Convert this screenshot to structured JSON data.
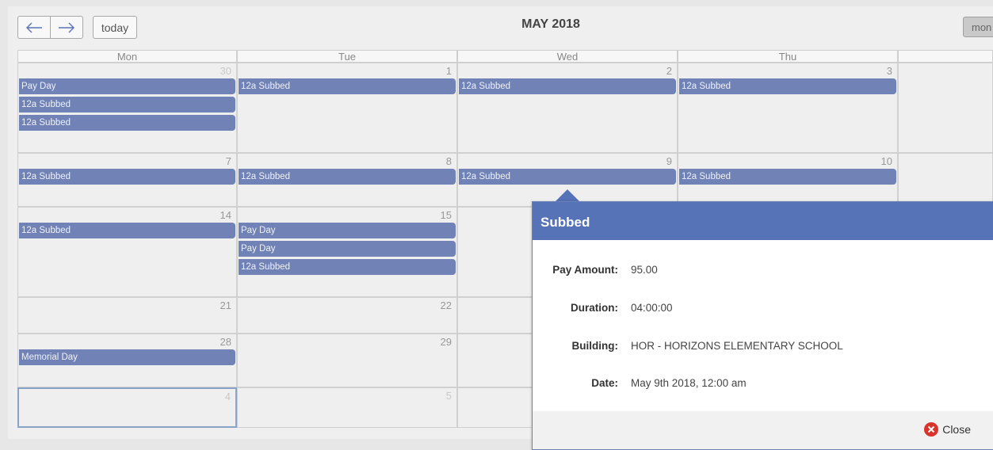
{
  "toolbar": {
    "prev_icon": "arrow-left-icon",
    "next_icon": "arrow-right-icon",
    "today_label": "today",
    "title": "MAY 2018",
    "view_label": "mon"
  },
  "days_of_week": [
    "Mon",
    "Tue",
    "Wed",
    "Thu"
  ],
  "weeks": [
    {
      "days": [
        {
          "num": "30",
          "other": true,
          "events": [
            "Pay Day",
            "12a Subbed",
            "12a Subbed"
          ]
        },
        {
          "num": "1",
          "events": [
            "12a Subbed"
          ]
        },
        {
          "num": "2",
          "events": [
            "12a Subbed"
          ]
        },
        {
          "num": "3",
          "events": [
            "12a Subbed"
          ]
        }
      ]
    },
    {
      "days": [
        {
          "num": "7",
          "events": [
            "12a Subbed"
          ]
        },
        {
          "num": "8",
          "events": [
            "12a Subbed"
          ]
        },
        {
          "num": "9",
          "events": [
            "12a Subbed"
          ]
        },
        {
          "num": "10",
          "events": [
            "12a Subbed"
          ]
        }
      ]
    },
    {
      "days": [
        {
          "num": "14",
          "events": [
            "12a Subbed"
          ]
        },
        {
          "num": "15",
          "events": [
            "Pay Day",
            "Pay Day",
            "12a Subbed"
          ]
        },
        {
          "num": "",
          "events": []
        },
        {
          "num": "",
          "events": []
        }
      ]
    },
    {
      "days": [
        {
          "num": "21",
          "events": []
        },
        {
          "num": "22",
          "events": []
        },
        {
          "num": "",
          "events": []
        },
        {
          "num": "",
          "events": []
        }
      ]
    },
    {
      "days": [
        {
          "num": "28",
          "events": [
            "Memorial Day"
          ]
        },
        {
          "num": "29",
          "events": []
        },
        {
          "num": "",
          "events": []
        },
        {
          "num": "",
          "events": []
        }
      ]
    },
    {
      "days": [
        {
          "num": "4",
          "other": true,
          "today": true,
          "events": []
        },
        {
          "num": "5",
          "other": true,
          "events": []
        },
        {
          "num": "",
          "events": []
        },
        {
          "num": "",
          "events": []
        }
      ]
    }
  ],
  "popover": {
    "title": "Subbed",
    "fields": [
      {
        "label": "Pay Amount:",
        "value": "95.00"
      },
      {
        "label": "Duration:",
        "value": "04:00:00"
      },
      {
        "label": "Building:",
        "value": "HOR - HORIZONS ELEMENTARY SCHOOL"
      },
      {
        "label": "Date:",
        "value": "May 9th 2018, 12:00 am"
      }
    ],
    "close_label": "Close",
    "close_icon": "close-circle-icon",
    "close_icon_color": "#d9342b"
  },
  "colors": {
    "event": "#7183b6",
    "header": "#5673b8"
  }
}
